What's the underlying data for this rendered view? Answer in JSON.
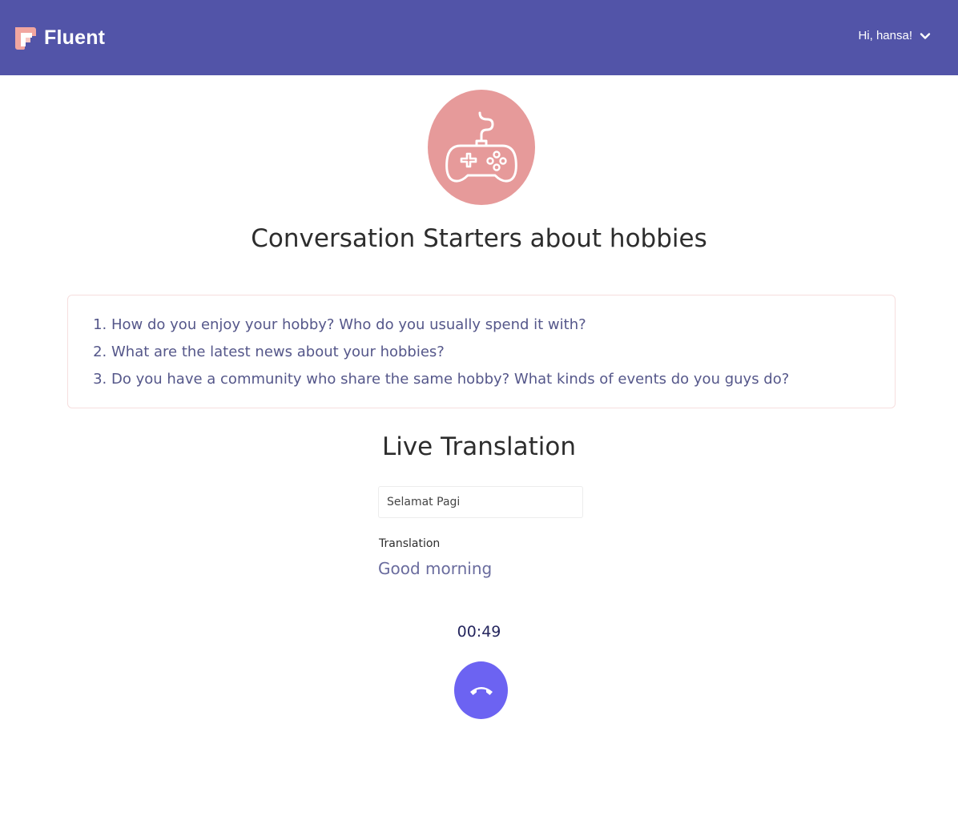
{
  "navbar": {
    "brand_name": "Fluent",
    "user_greeting": "Hi, hansa!",
    "logo_icon": "fluent-logo",
    "menu_icon": "chevron-down-icon",
    "bar_color": "#5254a8"
  },
  "topic": {
    "icon": "gamepad-icon",
    "icon_bg_color": "#e69a9a",
    "title": "Conversation Starters about hobbies"
  },
  "starters": [
    "How do you enjoy your hobby? Who do you usually spend it with?",
    "What are the latest news about your hobbies?",
    "Do you have a community who share the same hobby? What kinds of events do you guys do?"
  ],
  "live_translation": {
    "title": "Live Translation",
    "input_value": "Selamat Pagi",
    "translation_label": "Translation",
    "translation_value": "Good morning"
  },
  "call": {
    "timer": "00:49",
    "end_call_icon": "phone-hangup-icon",
    "button_color": "#6c63f2"
  }
}
